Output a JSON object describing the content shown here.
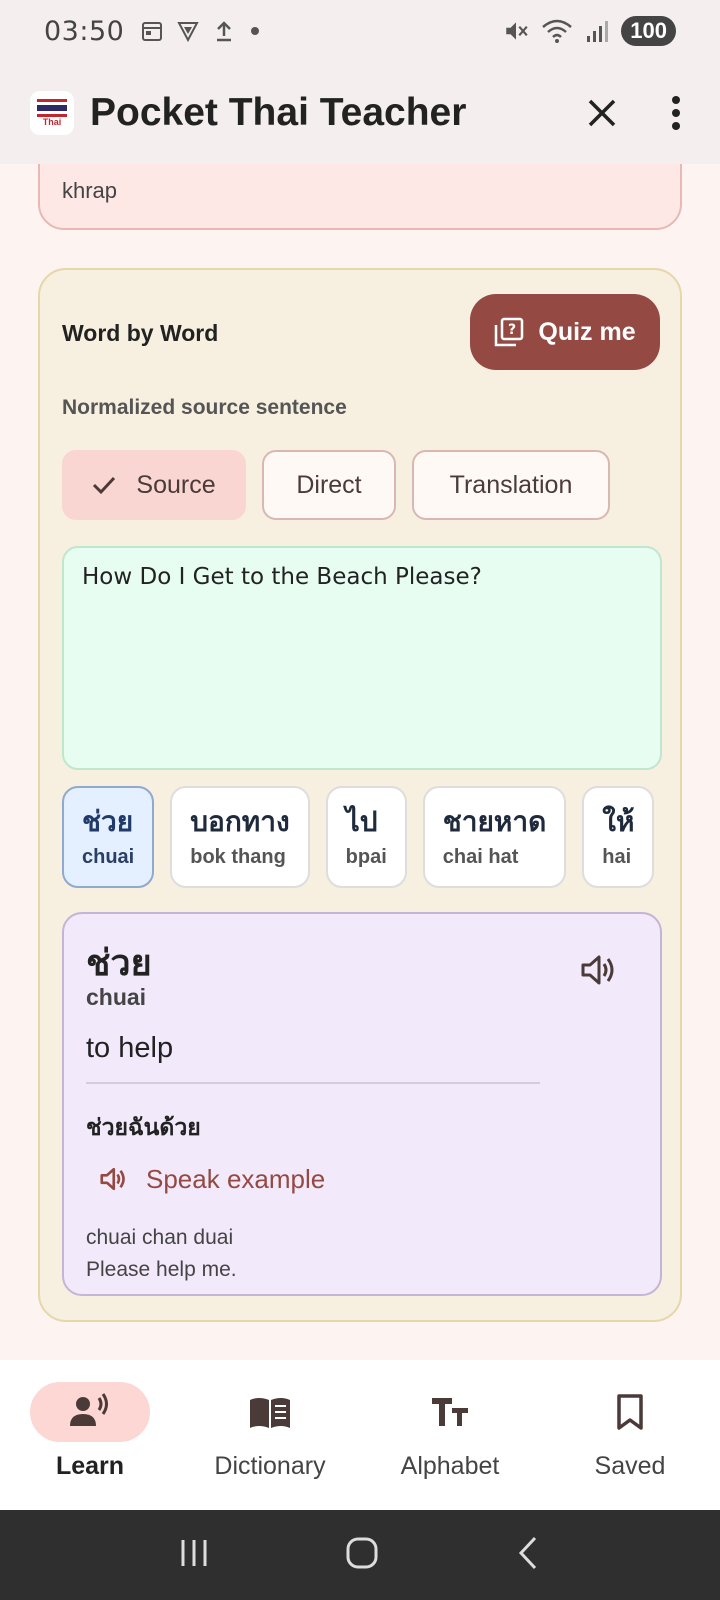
{
  "status_bar": {
    "time": "03:50",
    "battery": "100"
  },
  "app_bar": {
    "title": "Pocket Thai Teacher",
    "logo_text": "Thai"
  },
  "previous_card": {
    "text": "khrap"
  },
  "word_by_word": {
    "title": "Word by Word",
    "quiz_label": "Quiz me",
    "sub_label": "Normalized source sentence",
    "chips": [
      {
        "label": "Source",
        "selected": true
      },
      {
        "label": "Direct",
        "selected": false
      },
      {
        "label": "Translation",
        "selected": false
      }
    ],
    "sentence": "How Do I Get to the Beach Please?",
    "tokens": [
      {
        "thai": "ช่วย",
        "roman": "chuai"
      },
      {
        "thai": "บอกทาง",
        "roman": "bok thang"
      },
      {
        "thai": "ไป",
        "roman": "bpai"
      },
      {
        "thai": "ชายหาด",
        "roman": "chai hat"
      },
      {
        "thai": "ให้",
        "roman": "hai"
      }
    ],
    "detail": {
      "thai": "ช่วย",
      "roman": "chuai",
      "meaning": "to help",
      "example_thai": "ช่วยฉันด้วย",
      "speak_label": "Speak example",
      "example_roman": "chuai chan duai",
      "example_english": "Please help me."
    }
  },
  "bottom_nav": [
    {
      "label": "Learn",
      "icon": "learn-icon",
      "active": true
    },
    {
      "label": "Dictionary",
      "icon": "book-icon",
      "active": false
    },
    {
      "label": "Alphabet",
      "icon": "text-size-icon",
      "active": false
    },
    {
      "label": "Saved",
      "icon": "bookmark-icon",
      "active": false
    }
  ],
  "colors": {
    "accent": "#944a42",
    "chip_selected": "#f9d6d2",
    "card_bg": "#f7efdf",
    "sentence_bg": "#e8fdf2",
    "detail_bg": "#f2e9fb",
    "token_active_bg": "#e4efff"
  }
}
